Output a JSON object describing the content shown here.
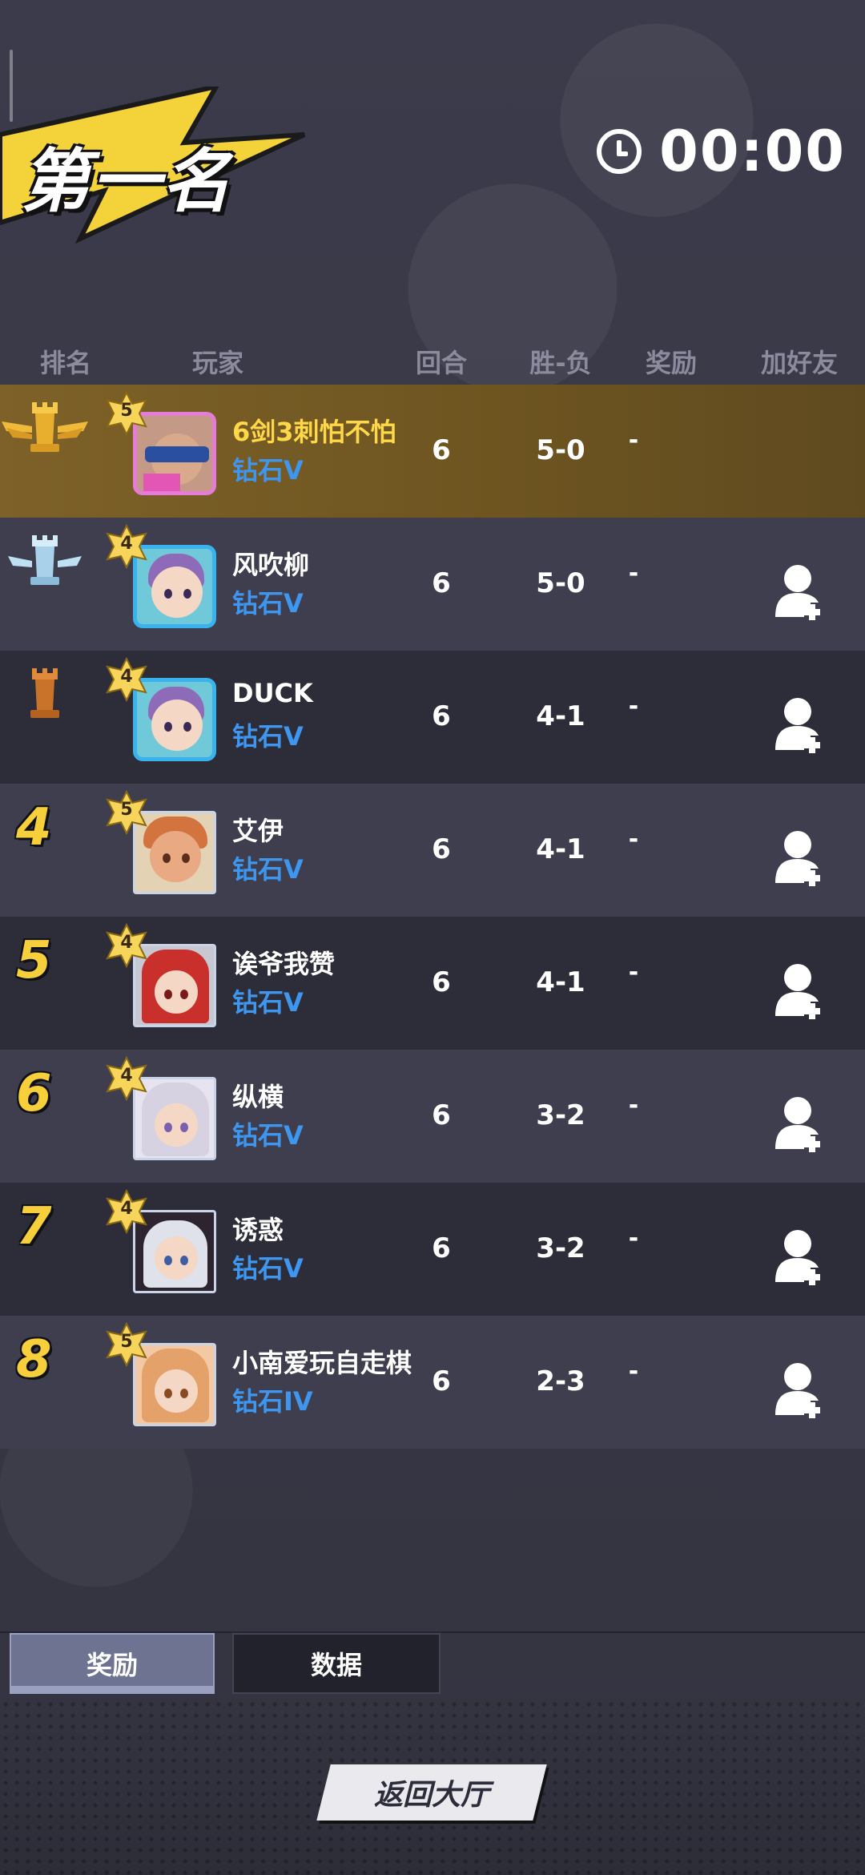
{
  "header": {
    "title": "第一名",
    "timer": "00:00"
  },
  "columns": [
    "排名",
    "玩家",
    "回合",
    "胜-负",
    "奖励",
    "加好友"
  ],
  "rows": [
    {
      "rank": "1",
      "stars": "5",
      "name": "6剑3刺怕不怕",
      "tier": "钻石V",
      "rounds": "6",
      "record": "5-0",
      "reward": "-"
    },
    {
      "rank": "2",
      "stars": "4",
      "name": "风吹柳",
      "tier": "钻石V",
      "rounds": "6",
      "record": "5-0",
      "reward": "-"
    },
    {
      "rank": "3",
      "stars": "4",
      "name": "DUCK",
      "tier": "钻石V",
      "rounds": "6",
      "record": "4-1",
      "reward": "-"
    },
    {
      "rank": "4",
      "stars": "5",
      "name": "艾伊",
      "tier": "钻石V",
      "rounds": "6",
      "record": "4-1",
      "reward": "-"
    },
    {
      "rank": "5",
      "stars": "4",
      "name": "诶爷我赞",
      "tier": "钻石V",
      "rounds": "6",
      "record": "4-1",
      "reward": "-"
    },
    {
      "rank": "6",
      "stars": "4",
      "name": "纵横",
      "tier": "钻石V",
      "rounds": "6",
      "record": "3-2",
      "reward": "-"
    },
    {
      "rank": "7",
      "stars": "4",
      "name": "诱惑",
      "tier": "钻石V",
      "rounds": "6",
      "record": "3-2",
      "reward": "-"
    },
    {
      "rank": "8",
      "stars": "5",
      "name": "小南爱玩自走棋",
      "tier": "钻石IV",
      "rounds": "6",
      "record": "2-3",
      "reward": "-"
    }
  ],
  "tabs": {
    "rewards": "奖励",
    "data": "数据"
  },
  "return_button": "返回大厅",
  "colors": {
    "gold": "#f6cf3a",
    "tier_blue": "#3f96ee",
    "highlight_row": "#7d6128"
  }
}
